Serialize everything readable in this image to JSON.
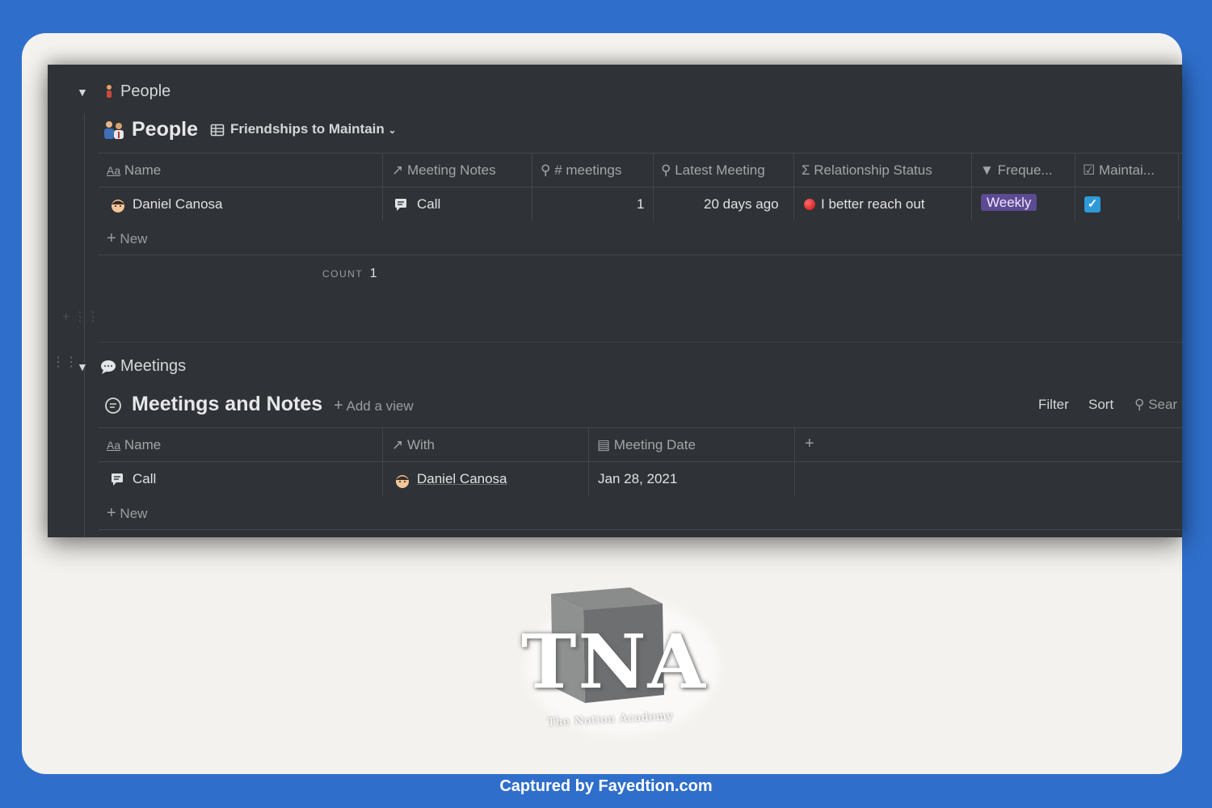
{
  "people_section": {
    "toggle_title": "People",
    "db_title": "People",
    "view_name": "Friendships to Maintain",
    "columns": [
      "Name",
      "Meeting Notes",
      "# meetings",
      "Latest Meeting",
      "Relationship Status",
      "Freque...",
      "Maintai..."
    ],
    "row": {
      "name": "Daniel Canosa",
      "meeting_notes": "Call",
      "meetings": "1",
      "latest_meeting": "20 days ago",
      "relationship_status": "I better reach out",
      "frequency": "Weekly",
      "maintain_checked": true
    },
    "new_label": "New",
    "count_label": "COUNT",
    "count_value": "1"
  },
  "meetings_section": {
    "toggle_title": "Meetings",
    "db_title": "Meetings and Notes",
    "add_view": "Add a view",
    "filter": "Filter",
    "sort": "Sort",
    "search": "Sear",
    "columns": [
      "Name",
      "With",
      "Meeting Date"
    ],
    "row": {
      "name": "Call",
      "with": "Daniel Canosa",
      "date": "Jan 28, 2021"
    },
    "new_label": "New"
  },
  "watermark": {
    "letters": "TNA",
    "tagline": "The Notion Academy"
  },
  "footer": "Captured by Fayedtion.com",
  "colors": {
    "frame": "#2f6fcb",
    "dark_bg": "#2f3236",
    "tag_purple": "#5d4a93",
    "checkbox_blue": "#2e9ad8"
  }
}
